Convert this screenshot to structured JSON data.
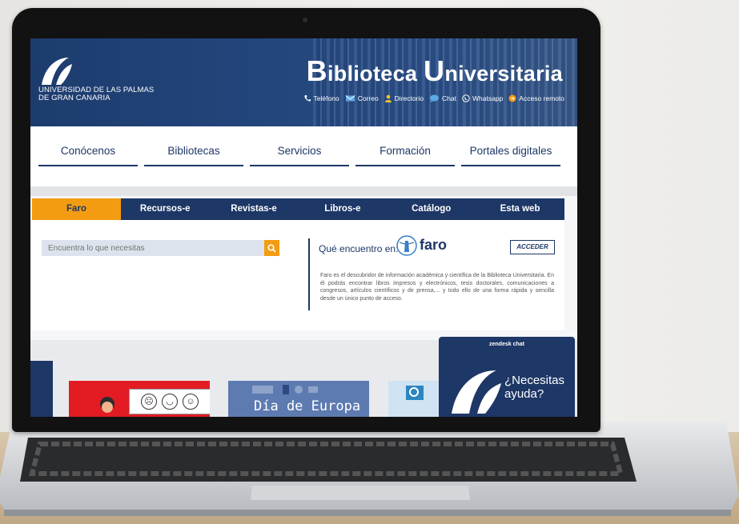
{
  "header": {
    "university": [
      "UNIVERSIDAD DE LAS PALMAS",
      "DE GRAN CANARIA"
    ],
    "title_word1_initial": "B",
    "title_word1_rest": "iblioteca ",
    "title_word2_initial": "U",
    "title_word2_rest": "niversitaria",
    "contacts": [
      {
        "label": "Teléfono",
        "icon": "phone-icon"
      },
      {
        "label": "Correo",
        "icon": "mail-icon"
      },
      {
        "label": "Directorio",
        "icon": "person-icon"
      },
      {
        "label": "Chat",
        "icon": "chat-icon"
      },
      {
        "label": "Whatsapp",
        "icon": "whatsapp-icon"
      },
      {
        "label": "Acceso remoto",
        "icon": "remote-access-icon"
      }
    ]
  },
  "nav": {
    "items": [
      "Conócenos",
      "Bibliotecas",
      "Servicios",
      "Formación",
      "Portales digitales"
    ]
  },
  "search": {
    "tabs": [
      "Faro",
      "Recursos-e",
      "Revistas-e",
      "Libros-e",
      "Catálogo",
      "Esta web"
    ],
    "active_tab": "Faro",
    "placeholder": "Encuentra lo que necesitas",
    "faro_label": "Qué encuentro en:",
    "faro_logo_text": "faro",
    "access_button": "ACCEDER",
    "description": "Faro es el descubridor de información académica y científica de la Biblioteca Universitaria. En él podrás encontrar libros impresos y electrónicos, tesis doctorales, comunicaciones a congresos, artículos científicos y de prensa,... y todo ello de una forma rápida y sencilla desde un único punto de acceso."
  },
  "cards": {
    "card2_text": "Día de Europa"
  },
  "chat": {
    "title": "zendesk chat",
    "line1": "¿Necesitas",
    "line2": "ayuda?"
  },
  "colors": {
    "primary": "#1d3766",
    "accent": "#f39c12",
    "red_card": "#e31b23"
  }
}
